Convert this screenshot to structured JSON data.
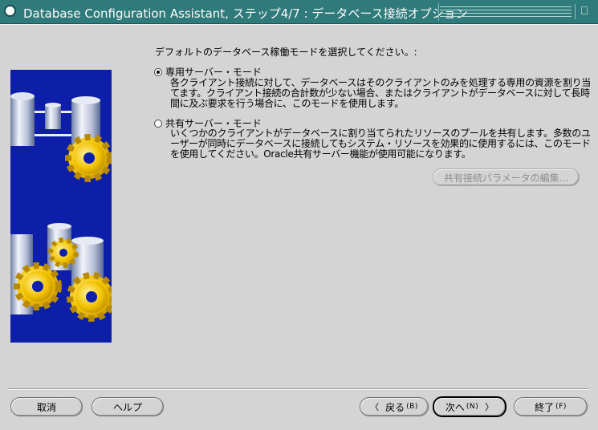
{
  "window": {
    "title": "Database Configuration Assistant, ステップ4/7 : データベース接続オプション",
    "maximize_glyph": "⎕"
  },
  "prompt": "デフォルトのデータベース稼働モードを選択してください。:",
  "options": [
    {
      "label": "専用サーバー・モード",
      "selected": true,
      "description": "各クライアント接続に対して、データベースはそのクライアントのみを処理する専用の資源を割り当てます。クライアント接続の合計数が少ない場合、またはクライアントがデータベースに対して長時間に及ぶ要求を行う場合に、このモードを使用します。"
    },
    {
      "label": "共有サーバー・モード",
      "selected": false,
      "description": "いくつかのクライアントがデータベースに割り当てられたリソースのプールを共有します。多数のユーザーが同時にデータベースに接続してもシステム・リソースを効果的に使用するには、このモードを使用してください。Oracle共有サーバー機能が使用可能になります。"
    }
  ],
  "shared_params_button": "共有接続パラメータの編集...",
  "footer": {
    "cancel": "取消",
    "help": "ヘルプ",
    "back": "戻る",
    "back_hint": "(B)",
    "next": "次へ",
    "next_hint": "(N)",
    "finish": "終了",
    "finish_hint": "(F)"
  },
  "colors": {
    "titlebar": "#2f7a7a",
    "illustration_bg": "#0d1ea8",
    "gear": "#f2c200",
    "window_bg": "#d4d4d4"
  }
}
